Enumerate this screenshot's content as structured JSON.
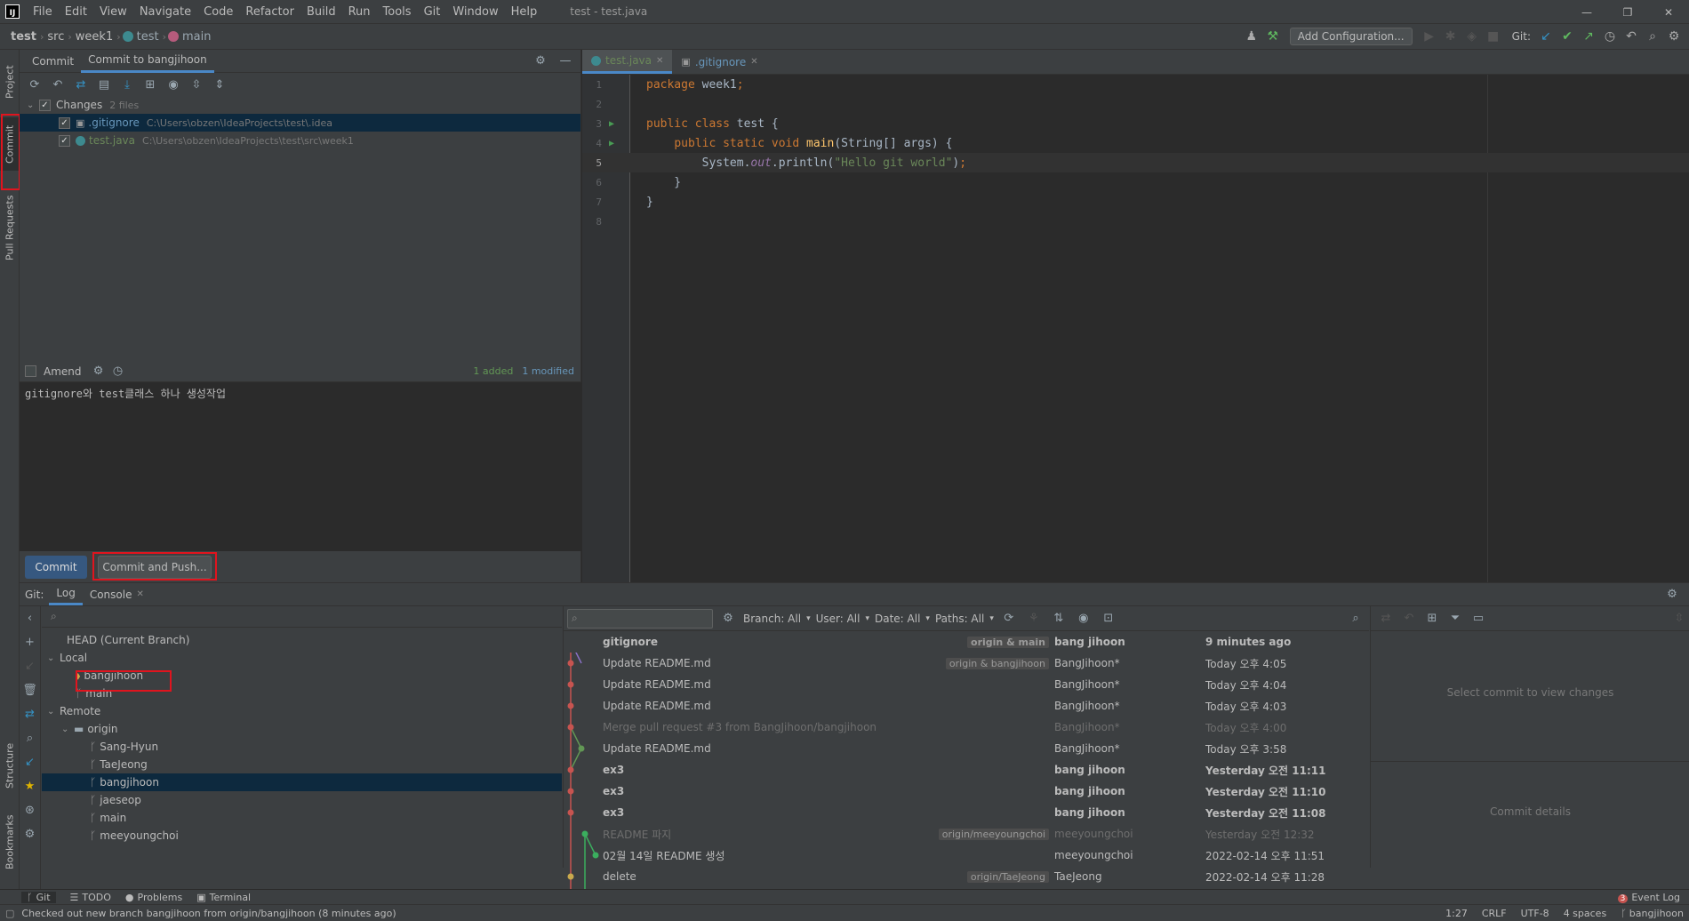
{
  "window": {
    "title": "test - test.java"
  },
  "menu": [
    "File",
    "Edit",
    "View",
    "Navigate",
    "Code",
    "Refactor",
    "Build",
    "Run",
    "Tools",
    "Git",
    "Window",
    "Help"
  ],
  "breadcrumb": [
    "test",
    "src",
    "week1",
    "test",
    "main"
  ],
  "toolbar": {
    "add_config": "Add Configuration...",
    "git_label": "Git:"
  },
  "side_tabs": {
    "project": "Project",
    "commit": "Commit",
    "pull_requests": "Pull Requests",
    "structure": "Structure",
    "bookmarks": "Bookmarks"
  },
  "commit_panel": {
    "tabs": [
      "Commit",
      "Commit to bangjihoon"
    ],
    "changes_label": "Changes",
    "changes_count": "2 files",
    "files": [
      {
        "name": ".gitignore",
        "path": "C:\\Users\\obzen\\IdeaProjects\\test\\.idea"
      },
      {
        "name": "test.java",
        "path": "C:\\Users\\obzen\\IdeaProjects\\test\\src\\week1"
      }
    ],
    "amend": "Amend",
    "added": "1 added",
    "modified": "1 modified",
    "message": "gitignore와 test클래스 하나 생성작업",
    "commit_btn": "Commit",
    "commit_push_btn": "Commit and Push..."
  },
  "editor": {
    "tabs": [
      "test.java",
      ".gitignore"
    ],
    "lines": [
      "1",
      "2",
      "3",
      "4",
      "5",
      "6",
      "7",
      "8"
    ]
  },
  "git_panel": {
    "label": "Git:",
    "tabs": [
      "Log",
      "Console"
    ],
    "head": "HEAD (Current Branch)",
    "local_label": "Local",
    "local": [
      "bangjihoon",
      "main"
    ],
    "remote_label": "Remote",
    "origin": "origin",
    "remote_branches": [
      "Sang-Hyun",
      "TaeJeong",
      "bangjihoon",
      "jaeseop",
      "main",
      "meeyoungchoi"
    ],
    "filters": {
      "branch": "Branch: All",
      "user": "User: All",
      "date": "Date: All",
      "paths": "Paths: All"
    },
    "commits": [
      {
        "msg": "gitignore",
        "tag": "origin & main",
        "author": "bang jihoon",
        "date": "9 minutes ago",
        "bold": true,
        "dim": false
      },
      {
        "msg": "Update README.md",
        "tag": "origin & bangjihoon",
        "author": "BangJihoon*",
        "date": "Today 오후 4:05",
        "bold": false,
        "dim": false
      },
      {
        "msg": "Update README.md",
        "tag": "",
        "author": "BangJihoon*",
        "date": "Today 오후 4:04",
        "bold": false,
        "dim": false
      },
      {
        "msg": "Update README.md",
        "tag": "",
        "author": "BangJihoon*",
        "date": "Today 오후 4:03",
        "bold": false,
        "dim": false
      },
      {
        "msg": "Merge pull request #3 from BangJihoon/bangjihoon",
        "tag": "",
        "author": "BangJihoon*",
        "date": "Today 오후 4:00",
        "bold": false,
        "dim": true
      },
      {
        "msg": "Update README.md",
        "tag": "",
        "author": "BangJihoon*",
        "date": "Today 오후 3:58",
        "bold": false,
        "dim": false
      },
      {
        "msg": "ex3",
        "tag": "",
        "author": "bang jihoon",
        "date": "Yesterday 오전 11:11",
        "bold": true,
        "dim": false
      },
      {
        "msg": "ex3",
        "tag": "",
        "author": "bang jihoon",
        "date": "Yesterday 오전 11:10",
        "bold": true,
        "dim": false
      },
      {
        "msg": "ex3",
        "tag": "",
        "author": "bang jihoon",
        "date": "Yesterday 오전 11:08",
        "bold": true,
        "dim": false
      },
      {
        "msg": "README 파지",
        "tag": "origin/meeyoungchoi",
        "author": "meeyoungchoi",
        "date": "Yesterday 오전 12:32",
        "bold": false,
        "dim": true
      },
      {
        "msg": "02월 14일 README 생성",
        "tag": "",
        "author": "meeyoungchoi",
        "date": "2022-02-14 오후 11:51",
        "bold": false,
        "dim": false
      },
      {
        "msg": "delete",
        "tag": "origin/TaeJeong",
        "author": "TaeJeong",
        "date": "2022-02-14 오후 11:28",
        "bold": false,
        "dim": false
      }
    ],
    "select_commit": "Select commit to view changes",
    "commit_details": "Commit details"
  },
  "bottom_tabs": {
    "git": "Git",
    "todo": "TODO",
    "problems": "Problems",
    "terminal": "Terminal",
    "event_log": "Event Log",
    "event_count": "3"
  },
  "status": {
    "message": "Checked out new branch bangjihoon from origin/bangjihoon (8 minutes ago)",
    "position": "1:27",
    "line_sep": "CRLF",
    "encoding": "UTF-8",
    "indent": "4 spaces",
    "branch": "bangjihoon"
  },
  "colors": {
    "accent": "#4a88c7",
    "highlight": "#e0141e"
  }
}
